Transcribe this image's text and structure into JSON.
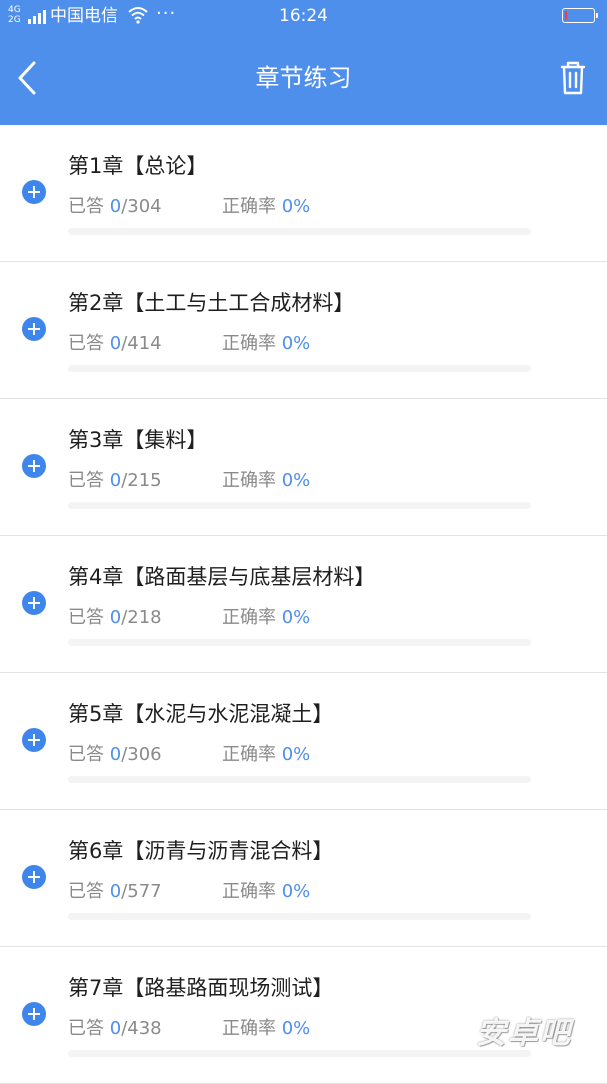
{
  "status_bar": {
    "network_top": "4G",
    "network_bottom": "2G",
    "carrier": "中国电信",
    "more": "···",
    "time": "16:24",
    "battery_level": 0.08
  },
  "nav": {
    "title": "章节练习",
    "back_icon": "chevron-left-icon",
    "action_icon": "trash-icon"
  },
  "labels": {
    "answered": "已答",
    "accuracy": "正确率"
  },
  "chapters": [
    {
      "title": "第1章【总论】",
      "answered": "0",
      "total": "/304",
      "accuracy": "0%",
      "progress": 0
    },
    {
      "title": "第2章【土工与土工合成材料】",
      "answered": "0",
      "total": "/414",
      "accuracy": "0%",
      "progress": 0
    },
    {
      "title": "第3章【集料】",
      "answered": "0",
      "total": "/215",
      "accuracy": "0%",
      "progress": 0
    },
    {
      "title": "第4章【路面基层与底基层材料】",
      "answered": "0",
      "total": "/218",
      "accuracy": "0%",
      "progress": 0
    },
    {
      "title": "第5章【水泥与水泥混凝土】",
      "answered": "0",
      "total": "/306",
      "accuracy": "0%",
      "progress": 0
    },
    {
      "title": "第6章【沥青与沥青混合料】",
      "answered": "0",
      "total": "/577",
      "accuracy": "0%",
      "progress": 0
    },
    {
      "title": "第7章【路基路面现场测试】",
      "answered": "0",
      "total": "/438",
      "accuracy": "0%",
      "progress": 0
    }
  ],
  "colors": {
    "primary": "#4f8fec",
    "plus_icon": "#3f86ec",
    "battery_low": "#ff3b30"
  },
  "watermark": "安卓吧"
}
